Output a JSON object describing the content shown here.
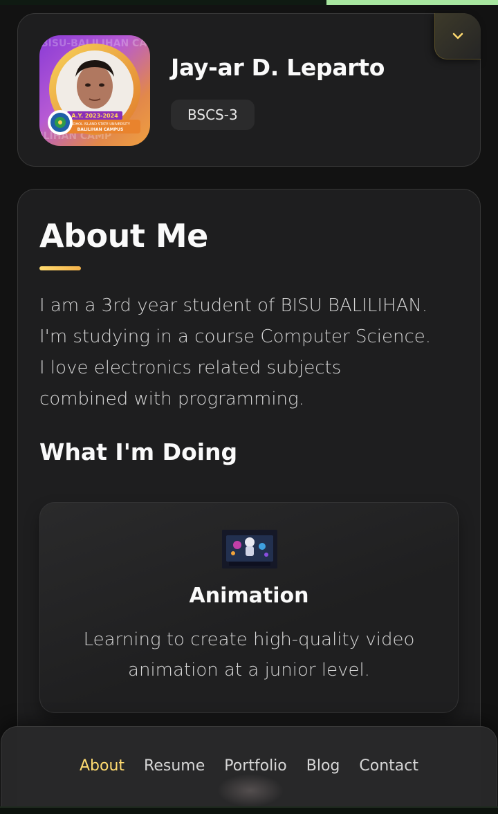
{
  "profile": {
    "name": "Jay-ar D. Leparto",
    "title": "BSCS-3",
    "avatar": {
      "banner_text": "BISU-BALILIHAN CAMP",
      "year_text": "A.Y. 2023-2024",
      "school_text": "BOHOL ISLAND STATE UNIVERSITY",
      "campus_text": "BALILIHAN CAMPUS"
    },
    "expand_icon": "chevron-down-icon"
  },
  "about": {
    "title": "About Me",
    "paragraph_lines": [
      "I am a 3rd year student of BISU BALILIHAN.",
      "I'm studying in a course Computer Science.",
      "I love electronics related subjects",
      "combined with programming."
    ],
    "services_title": "What I'm Doing",
    "services": [
      {
        "icon": "animation-icon",
        "title": "Animation",
        "text_lines": [
          "Learning to create high-quality video",
          "animation at a junior level."
        ]
      }
    ]
  },
  "navbar": {
    "links": [
      "About",
      "Resume",
      "Portfolio",
      "Blog",
      "Contact"
    ],
    "active": "About"
  },
  "colors": {
    "accent": "#ffdb70",
    "card_bg": "#1e1e1f",
    "page_bg": "#121212"
  }
}
